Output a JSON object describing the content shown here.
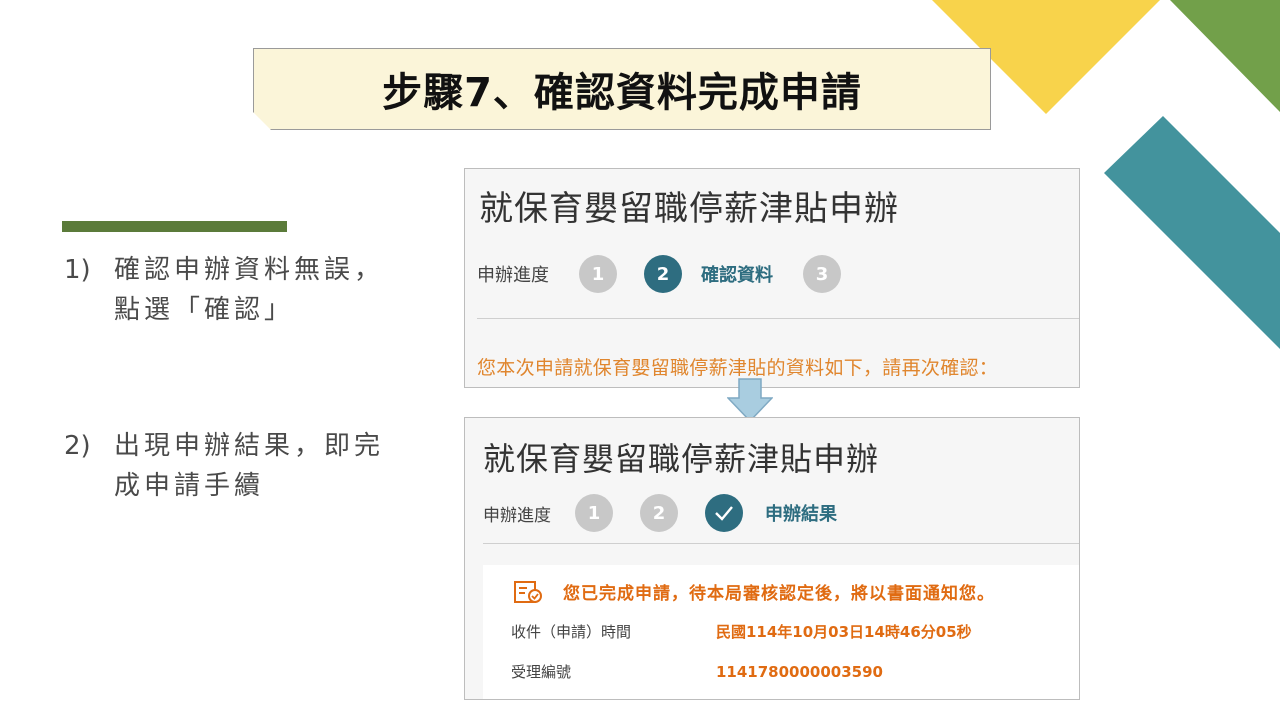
{
  "title": "步驟7、確認資料完成申請",
  "steps": [
    {
      "num": "1)",
      "line1": "確認申辦資料無誤，",
      "line2": "點選「確認」"
    },
    {
      "num": "2)",
      "line1": "出現申辦結果，即完",
      "line2": "成申請手續"
    }
  ],
  "panel1": {
    "heading": "就保育嬰留職停薪津貼申辦",
    "progress_label": "申辦進度",
    "circles": [
      "1",
      "2",
      "3"
    ],
    "current_label": "確認資料",
    "confirm_text": "您本次申請就保育嬰留職停薪津貼的資料如下，請再次確認："
  },
  "panel2": {
    "heading": "就保育嬰留職停薪津貼申辦",
    "progress_label": "申辦進度",
    "circles": [
      "1",
      "2"
    ],
    "current_label": "申辦結果",
    "result_message": "您已完成申請，待本局審核認定後，將以書面通知您。",
    "fields": [
      {
        "key": "收件（申請）時間",
        "value": "民國114年10月03日14時46分05秒"
      },
      {
        "key": "受理編號",
        "value": "1141780000003590"
      }
    ]
  },
  "colors": {
    "accent_teal": "#2e6d80",
    "orange_text": "#e06b12",
    "deco_yellow": "#f8d34b",
    "deco_green": "#72a04a",
    "deco_teal": "#43939d",
    "bar_green": "#5b7b3a"
  },
  "icons": {
    "arrow": "down-arrow-icon",
    "check": "check-icon",
    "document": "document-check-icon"
  }
}
